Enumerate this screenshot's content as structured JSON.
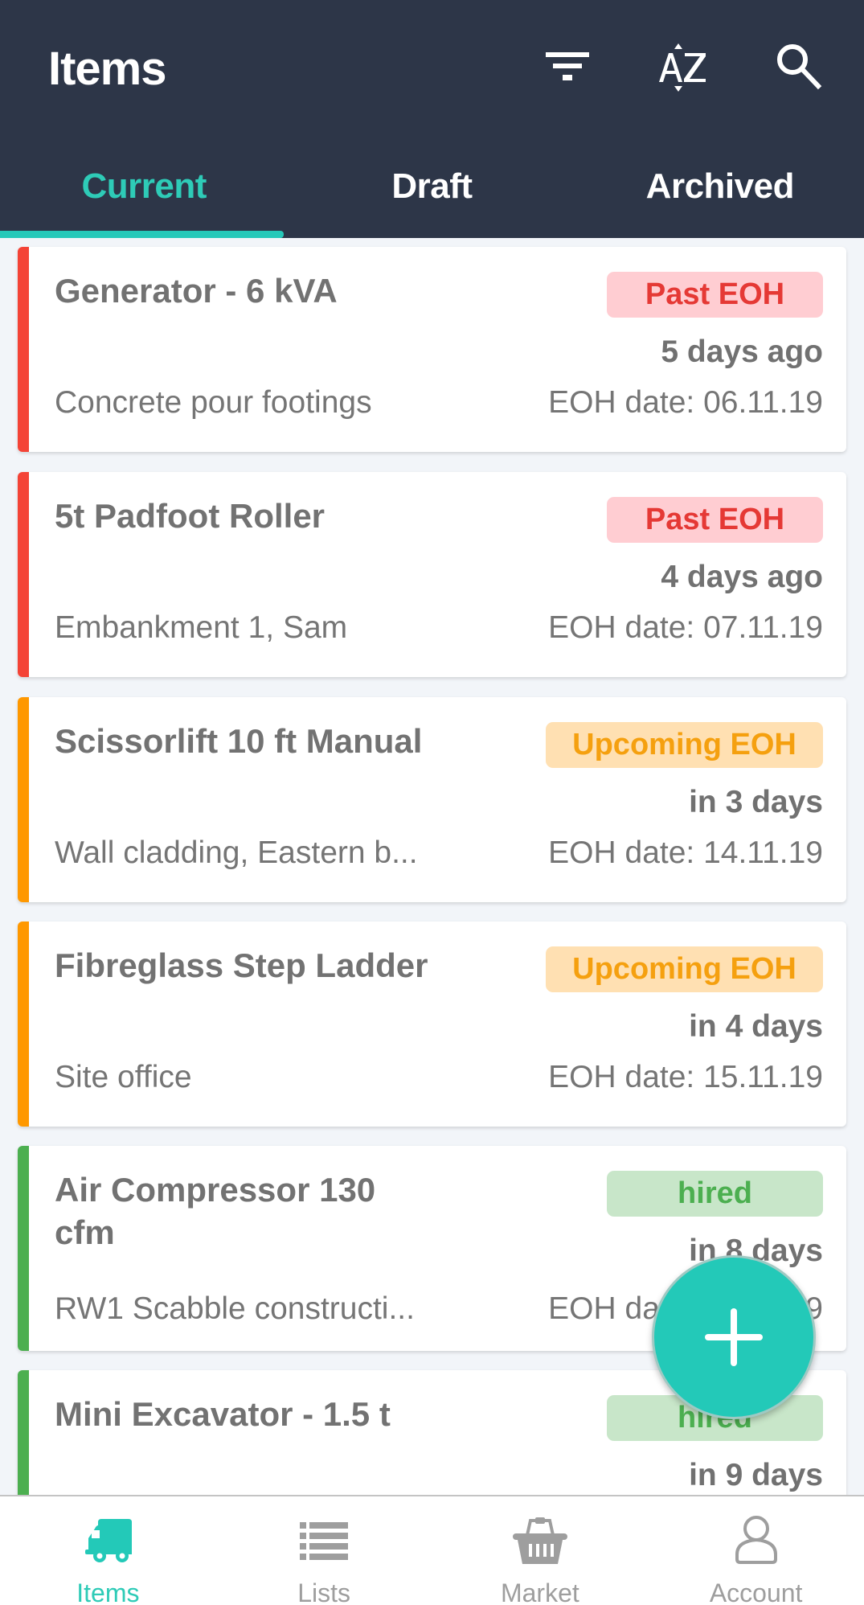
{
  "header": {
    "title": "Items",
    "actions": [
      {
        "name": "filter",
        "icon": "filter-icon"
      },
      {
        "name": "sort",
        "icon": "sort-az-icon"
      },
      {
        "name": "search",
        "icon": "search-icon"
      }
    ]
  },
  "tabs": [
    {
      "label": "Current",
      "active": true
    },
    {
      "label": "Draft",
      "active": false
    },
    {
      "label": "Archived",
      "active": false
    }
  ],
  "colors": {
    "header_bg": "#2d3648",
    "accent": "#26c9b9",
    "past": "#e53935",
    "past_bg": "#ffcdd2",
    "upcoming": "#f5a00f",
    "upcoming_bg": "#ffe0b2",
    "hired": "#4caf50",
    "hired_bg": "#c8e6c9"
  },
  "items": [
    {
      "name": "Generator - 6 kVA",
      "status": "Past EOH",
      "status_type": "past",
      "when": "5 days ago",
      "site": "Concrete pour footings",
      "eoh": "EOH date: 06.11.19"
    },
    {
      "name": "5t Padfoot Roller",
      "status": "Past EOH",
      "status_type": "past",
      "when": "4 days ago",
      "site": "Embankment 1, Sam",
      "eoh": "EOH date: 07.11.19"
    },
    {
      "name": "Scissorlift 10 ft Manual",
      "status": "Upcoming EOH",
      "status_type": "upcoming",
      "when": "in 3 days",
      "site": "Wall cladding, Eastern b...",
      "eoh": "EOH date: 14.11.19"
    },
    {
      "name": "Fibreglass Step Ladder",
      "status": "Upcoming EOH",
      "status_type": "upcoming",
      "when": "in 4 days",
      "site": "Site office",
      "eoh": "EOH date: 15.11.19"
    },
    {
      "name": "Air Compressor 130 cfm",
      "status": "hired",
      "status_type": "hired",
      "when": "in 8 days",
      "site": "RW1 Scabble constructi...",
      "eoh": "EOH date: 16.11.19"
    },
    {
      "name": "Mini Excavator - 1.5 t",
      "status": "hired",
      "status_type": "hired",
      "when": "in 9 days",
      "site": "",
      "eoh": ""
    }
  ],
  "fab": {
    "icon": "plus-icon",
    "label": "Add item"
  },
  "bottom_nav": [
    {
      "label": "Items",
      "icon": "truck-icon",
      "active": true
    },
    {
      "label": "Lists",
      "icon": "list-icon",
      "active": false
    },
    {
      "label": "Market",
      "icon": "basket-icon",
      "active": false
    },
    {
      "label": "Account",
      "icon": "user-icon",
      "active": false
    }
  ]
}
